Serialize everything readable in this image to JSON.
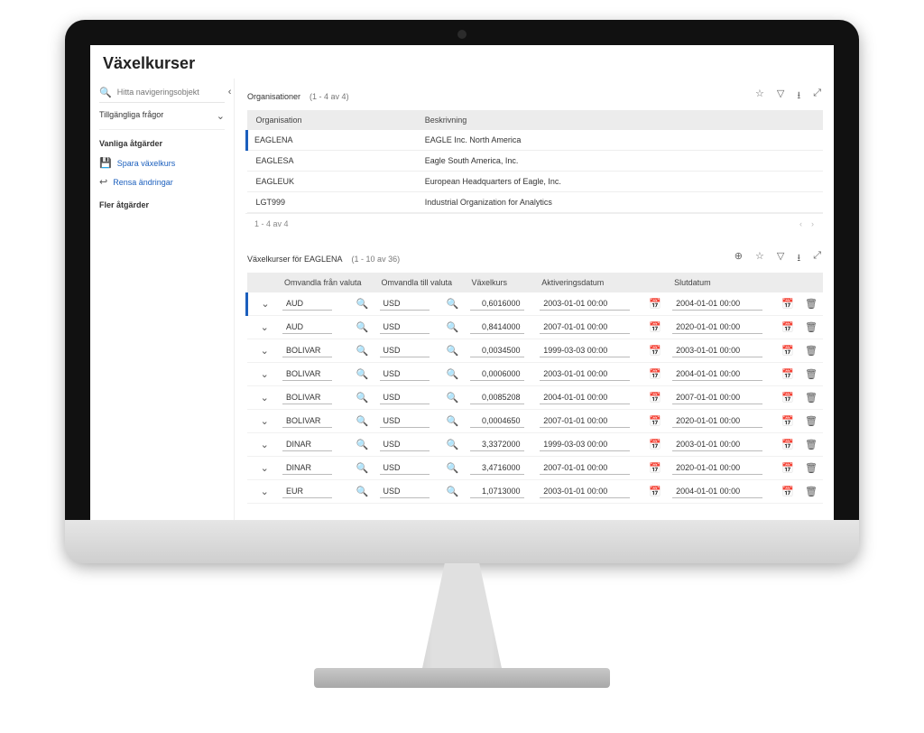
{
  "page": {
    "title": "Växelkurser"
  },
  "sidebar": {
    "search_placeholder": "Hitta navigeringsobjekt",
    "available_queries": "Tillgängliga frågor",
    "common_actions": "Vanliga åtgärder",
    "save_link": "Spara växelkurs",
    "clear_link": "Rensa ändringar",
    "more_actions": "Fler åtgärder"
  },
  "orgs": {
    "panel_title": "Organisationer",
    "count_label": "(1 - 4 av 4)",
    "col_org": "Organisation",
    "col_desc": "Beskrivning",
    "rows": [
      {
        "org": "EAGLENA",
        "desc": "EAGLE Inc. North America"
      },
      {
        "org": "EAGLESA",
        "desc": "Eagle South America, Inc."
      },
      {
        "org": "EAGLEUK",
        "desc": "European Headquarters of Eagle, Inc."
      },
      {
        "org": "LGT999",
        "desc": "Industrial Organization for Analytics"
      }
    ],
    "footer_count": "1 - 4 av 4"
  },
  "rates": {
    "panel_title": "Växelkurser för EAGLENA",
    "count_label": "(1 - 10 av 36)",
    "col_from": "Omvandla från valuta",
    "col_to": "Omvandla till valuta",
    "col_rate": "Växelkurs",
    "col_start": "Aktiveringsdatum",
    "col_end": "Slutdatum",
    "rows": [
      {
        "from": "AUD",
        "to": "USD",
        "rate": "0,6016000",
        "start": "2003-01-01 00:00",
        "end": "2004-01-01 00:00"
      },
      {
        "from": "AUD",
        "to": "USD",
        "rate": "0,8414000",
        "start": "2007-01-01 00:00",
        "end": "2020-01-01 00:00"
      },
      {
        "from": "BOLIVAR",
        "to": "USD",
        "rate": "0,0034500",
        "start": "1999-03-03 00:00",
        "end": "2003-01-01 00:00"
      },
      {
        "from": "BOLIVAR",
        "to": "USD",
        "rate": "0,0006000",
        "start": "2003-01-01 00:00",
        "end": "2004-01-01 00:00"
      },
      {
        "from": "BOLIVAR",
        "to": "USD",
        "rate": "0,0085208",
        "start": "2004-01-01 00:00",
        "end": "2007-01-01 00:00"
      },
      {
        "from": "BOLIVAR",
        "to": "USD",
        "rate": "0,0004650",
        "start": "2007-01-01 00:00",
        "end": "2020-01-01 00:00"
      },
      {
        "from": "DINAR",
        "to": "USD",
        "rate": "3,3372000",
        "start": "1999-03-03 00:00",
        "end": "2003-01-01 00:00"
      },
      {
        "from": "DINAR",
        "to": "USD",
        "rate": "3,4716000",
        "start": "2007-01-01 00:00",
        "end": "2020-01-01 00:00"
      },
      {
        "from": "EUR",
        "to": "USD",
        "rate": "1,0713000",
        "start": "2003-01-01 00:00",
        "end": "2004-01-01 00:00"
      }
    ]
  }
}
